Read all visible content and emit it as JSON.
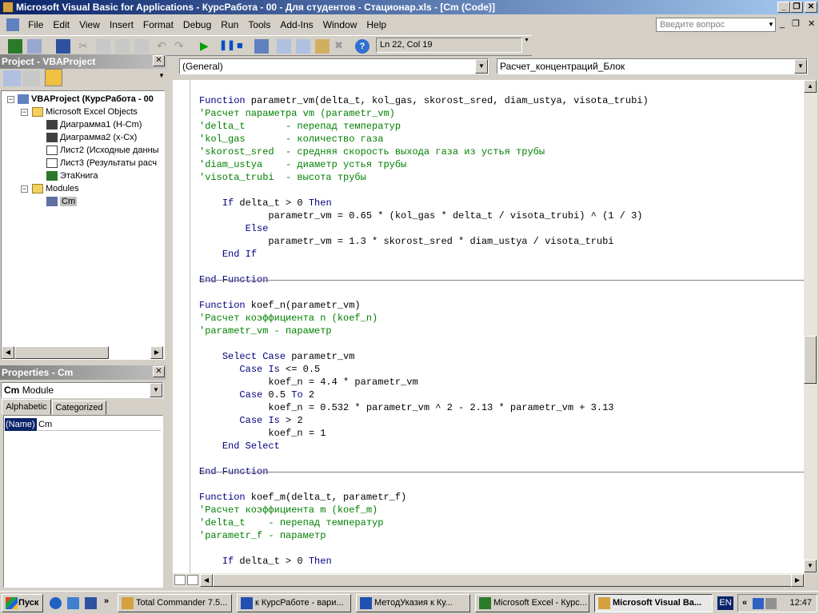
{
  "window": {
    "title": "Microsoft Visual Basic for Applications - КурсРабота - 00 - Для студентов - Стационар.xls - [Cm (Code)]"
  },
  "menu": [
    "File",
    "Edit",
    "View",
    "Insert",
    "Format",
    "Debug",
    "Run",
    "Tools",
    "Add-Ins",
    "Window",
    "Help"
  ],
  "help_box": {
    "placeholder": "Введите вопрос"
  },
  "toolbar": {
    "position": "Ln 22, Col 19"
  },
  "project": {
    "title": "Project - VBAProject",
    "root": "VBAProject (КурсРабота - 00",
    "excel_objects": "Microsoft Excel Objects",
    "items": [
      "Диаграмма1 (Н-Cm)",
      "Диаграмма2 (x-Cx)",
      "Лист2 (Исходные данны",
      "Лист3 (Результаты расч",
      "ЭтаКнига"
    ],
    "modules": "Modules",
    "module_items": [
      "Cm"
    ]
  },
  "properties": {
    "title": "Properties - Cm",
    "object": "Cm",
    "object_type": "Module",
    "tabs": [
      "Alphabetic",
      "Categorized"
    ],
    "rows": [
      {
        "name": "(Name)",
        "value": "Cm"
      }
    ]
  },
  "editor": {
    "object_combo": "(General)",
    "proc_combo": "Расчет_концентраций_Блок",
    "lines": [
      {
        "t": "Function parametr_vm(delta_t, kol_gas, skorost_sred, diam_ustya, visota_trubi)",
        "c": "code"
      },
      {
        "t": "'Расчет параметра vm (parametr_vm)",
        "c": "cm"
      },
      {
        "t": "'delta_t       - перепад температур",
        "c": "cm"
      },
      {
        "t": "'kol_gas       - количество газа",
        "c": "cm"
      },
      {
        "t": "'skorost_sred  - средняя скорость выхода газа из устья трубы",
        "c": "cm"
      },
      {
        "t": "'diam_ustya    - диаметр устья трубы",
        "c": "cm"
      },
      {
        "t": "'visota_trubi  - высота трубы",
        "c": "cm"
      },
      {
        "t": "",
        "c": "code"
      },
      {
        "t": "    If delta_t > 0 Then",
        "c": "code"
      },
      {
        "t": "            parametr_vm = 0.65 * (kol_gas * delta_t / visota_trubi) ^ (1 / 3)",
        "c": "code"
      },
      {
        "t": "        Else",
        "c": "code"
      },
      {
        "t": "            parametr_vm = 1.3 * skorost_sred * diam_ustya / visota_trubi",
        "c": "code"
      },
      {
        "t": "    End If",
        "c": "code"
      },
      {
        "t": "",
        "c": "code"
      },
      {
        "t": "End Function",
        "c": "code",
        "sep": true
      },
      {
        "t": "",
        "c": "code"
      },
      {
        "t": "Function koef_n(parametr_vm)",
        "c": "code"
      },
      {
        "t": "'Расчет коэффициента n (koef_n)",
        "c": "cm"
      },
      {
        "t": "'parametr_vm - параметр",
        "c": "cm"
      },
      {
        "t": "",
        "c": "code"
      },
      {
        "t": "    Select Case parametr_vm",
        "c": "code"
      },
      {
        "t": "       Case Is <= 0.5",
        "c": "code"
      },
      {
        "t": "            koef_n = 4.4 * parametr_vm",
        "c": "code"
      },
      {
        "t": "       Case 0.5 To 2",
        "c": "code"
      },
      {
        "t": "            koef_n = 0.532 * parametr_vm ^ 2 - 2.13 * parametr_vm + 3.13",
        "c": "code"
      },
      {
        "t": "       Case Is > 2",
        "c": "code"
      },
      {
        "t": "            koef_n = 1",
        "c": "code"
      },
      {
        "t": "    End Select",
        "c": "code"
      },
      {
        "t": "",
        "c": "code"
      },
      {
        "t": "End Function",
        "c": "code",
        "sep": true
      },
      {
        "t": "",
        "c": "code"
      },
      {
        "t": "Function koef_m(delta_t, parametr_f)",
        "c": "code"
      },
      {
        "t": "'Расчет коэффициента m (koef_m)",
        "c": "cm"
      },
      {
        "t": "'delta_t    - перепад температур",
        "c": "cm"
      },
      {
        "t": "'parametr_f - параметр",
        "c": "cm"
      },
      {
        "t": "",
        "c": "code"
      },
      {
        "t": "    If delta_t > 0 Then",
        "c": "code"
      }
    ]
  },
  "taskbar": {
    "start": "Пуск",
    "tasks": [
      {
        "label": "Total Commander 7.5...",
        "active": false
      },
      {
        "label": "к КурсРаботе - вари...",
        "active": false
      },
      {
        "label": "МетодУказия к Ку...",
        "active": false
      },
      {
        "label": "Microsoft Excel - Курс...",
        "active": false
      },
      {
        "label": "Microsoft Visual Ba...",
        "active": true
      }
    ],
    "lang": "EN",
    "clock": "12:47"
  },
  "colors": {
    "keyword": "#00007f",
    "comment": "#007f00",
    "title_start": "#0a246a",
    "title_end": "#a6caf0"
  }
}
